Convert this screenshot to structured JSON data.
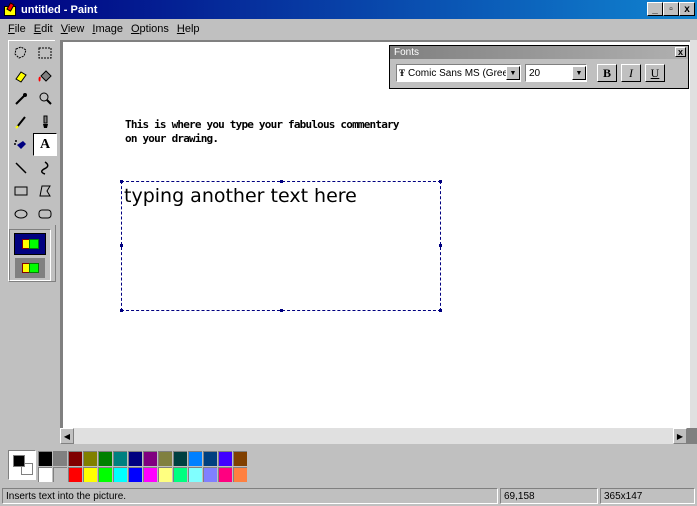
{
  "window": {
    "title": "untitled - Paint",
    "controls": {
      "minimize": "_",
      "maximize": "▫",
      "close": "x"
    }
  },
  "menu": {
    "items": [
      {
        "label": "File",
        "u": "F",
        "rest": "ile"
      },
      {
        "label": "Edit",
        "u": "E",
        "rest": "dit"
      },
      {
        "label": "View",
        "u": "V",
        "rest": "iew"
      },
      {
        "label": "Image",
        "u": "I",
        "rest": "mage"
      },
      {
        "label": "Options",
        "u": "O",
        "rest": "ptions"
      },
      {
        "label": "Help",
        "u": "H",
        "rest": "elp"
      }
    ]
  },
  "tools": [
    {
      "name": "free-form-select",
      "icon": "free-select-icon"
    },
    {
      "name": "select",
      "icon": "rect-select-icon"
    },
    {
      "name": "eraser",
      "icon": "eraser-icon"
    },
    {
      "name": "fill-with-color",
      "icon": "fill-bucket-icon"
    },
    {
      "name": "pick-color",
      "icon": "eyedropper-icon"
    },
    {
      "name": "magnifier",
      "icon": "magnifier-icon"
    },
    {
      "name": "pencil",
      "icon": "pencil-icon"
    },
    {
      "name": "brush",
      "icon": "brush-icon"
    },
    {
      "name": "airbrush",
      "icon": "airbrush-icon"
    },
    {
      "name": "text",
      "icon": "text-icon",
      "glyph": "A",
      "active": true
    },
    {
      "name": "line",
      "icon": "line-icon"
    },
    {
      "name": "curve",
      "icon": "curve-icon"
    },
    {
      "name": "rectangle",
      "icon": "rectangle-icon"
    },
    {
      "name": "polygon",
      "icon": "polygon-icon"
    },
    {
      "name": "ellipse",
      "icon": "ellipse-icon"
    },
    {
      "name": "rounded-rectangle",
      "icon": "rounded-rect-icon"
    }
  ],
  "canvas": {
    "commentary": "This is where you type your fabulous commentary on your drawing.",
    "typed_text": "typing another text here"
  },
  "fonts_toolbar": {
    "title": "Fonts",
    "font_name": "Comic Sans MS (Greek)",
    "font_size": "20",
    "bold": "B",
    "italic": "I",
    "underline": "U"
  },
  "palette": {
    "foreground": "#000000",
    "background": "#ffffff",
    "colors": [
      "#000000",
      "#808080",
      "#800000",
      "#808000",
      "#008000",
      "#008080",
      "#000080",
      "#800080",
      "#808040",
      "#004040",
      "#0080ff",
      "#004080",
      "#4000ff",
      "#804000",
      "#ffffff",
      "#c0c0c0",
      "#ff0000",
      "#ffff00",
      "#00ff00",
      "#00ffff",
      "#0000ff",
      "#ff00ff",
      "#ffff80",
      "#00ff80",
      "#80ffff",
      "#8080ff",
      "#ff0080",
      "#ff8040"
    ]
  },
  "status": {
    "message": "Inserts text into the picture.",
    "coords": "69,158",
    "size": "365x147"
  }
}
